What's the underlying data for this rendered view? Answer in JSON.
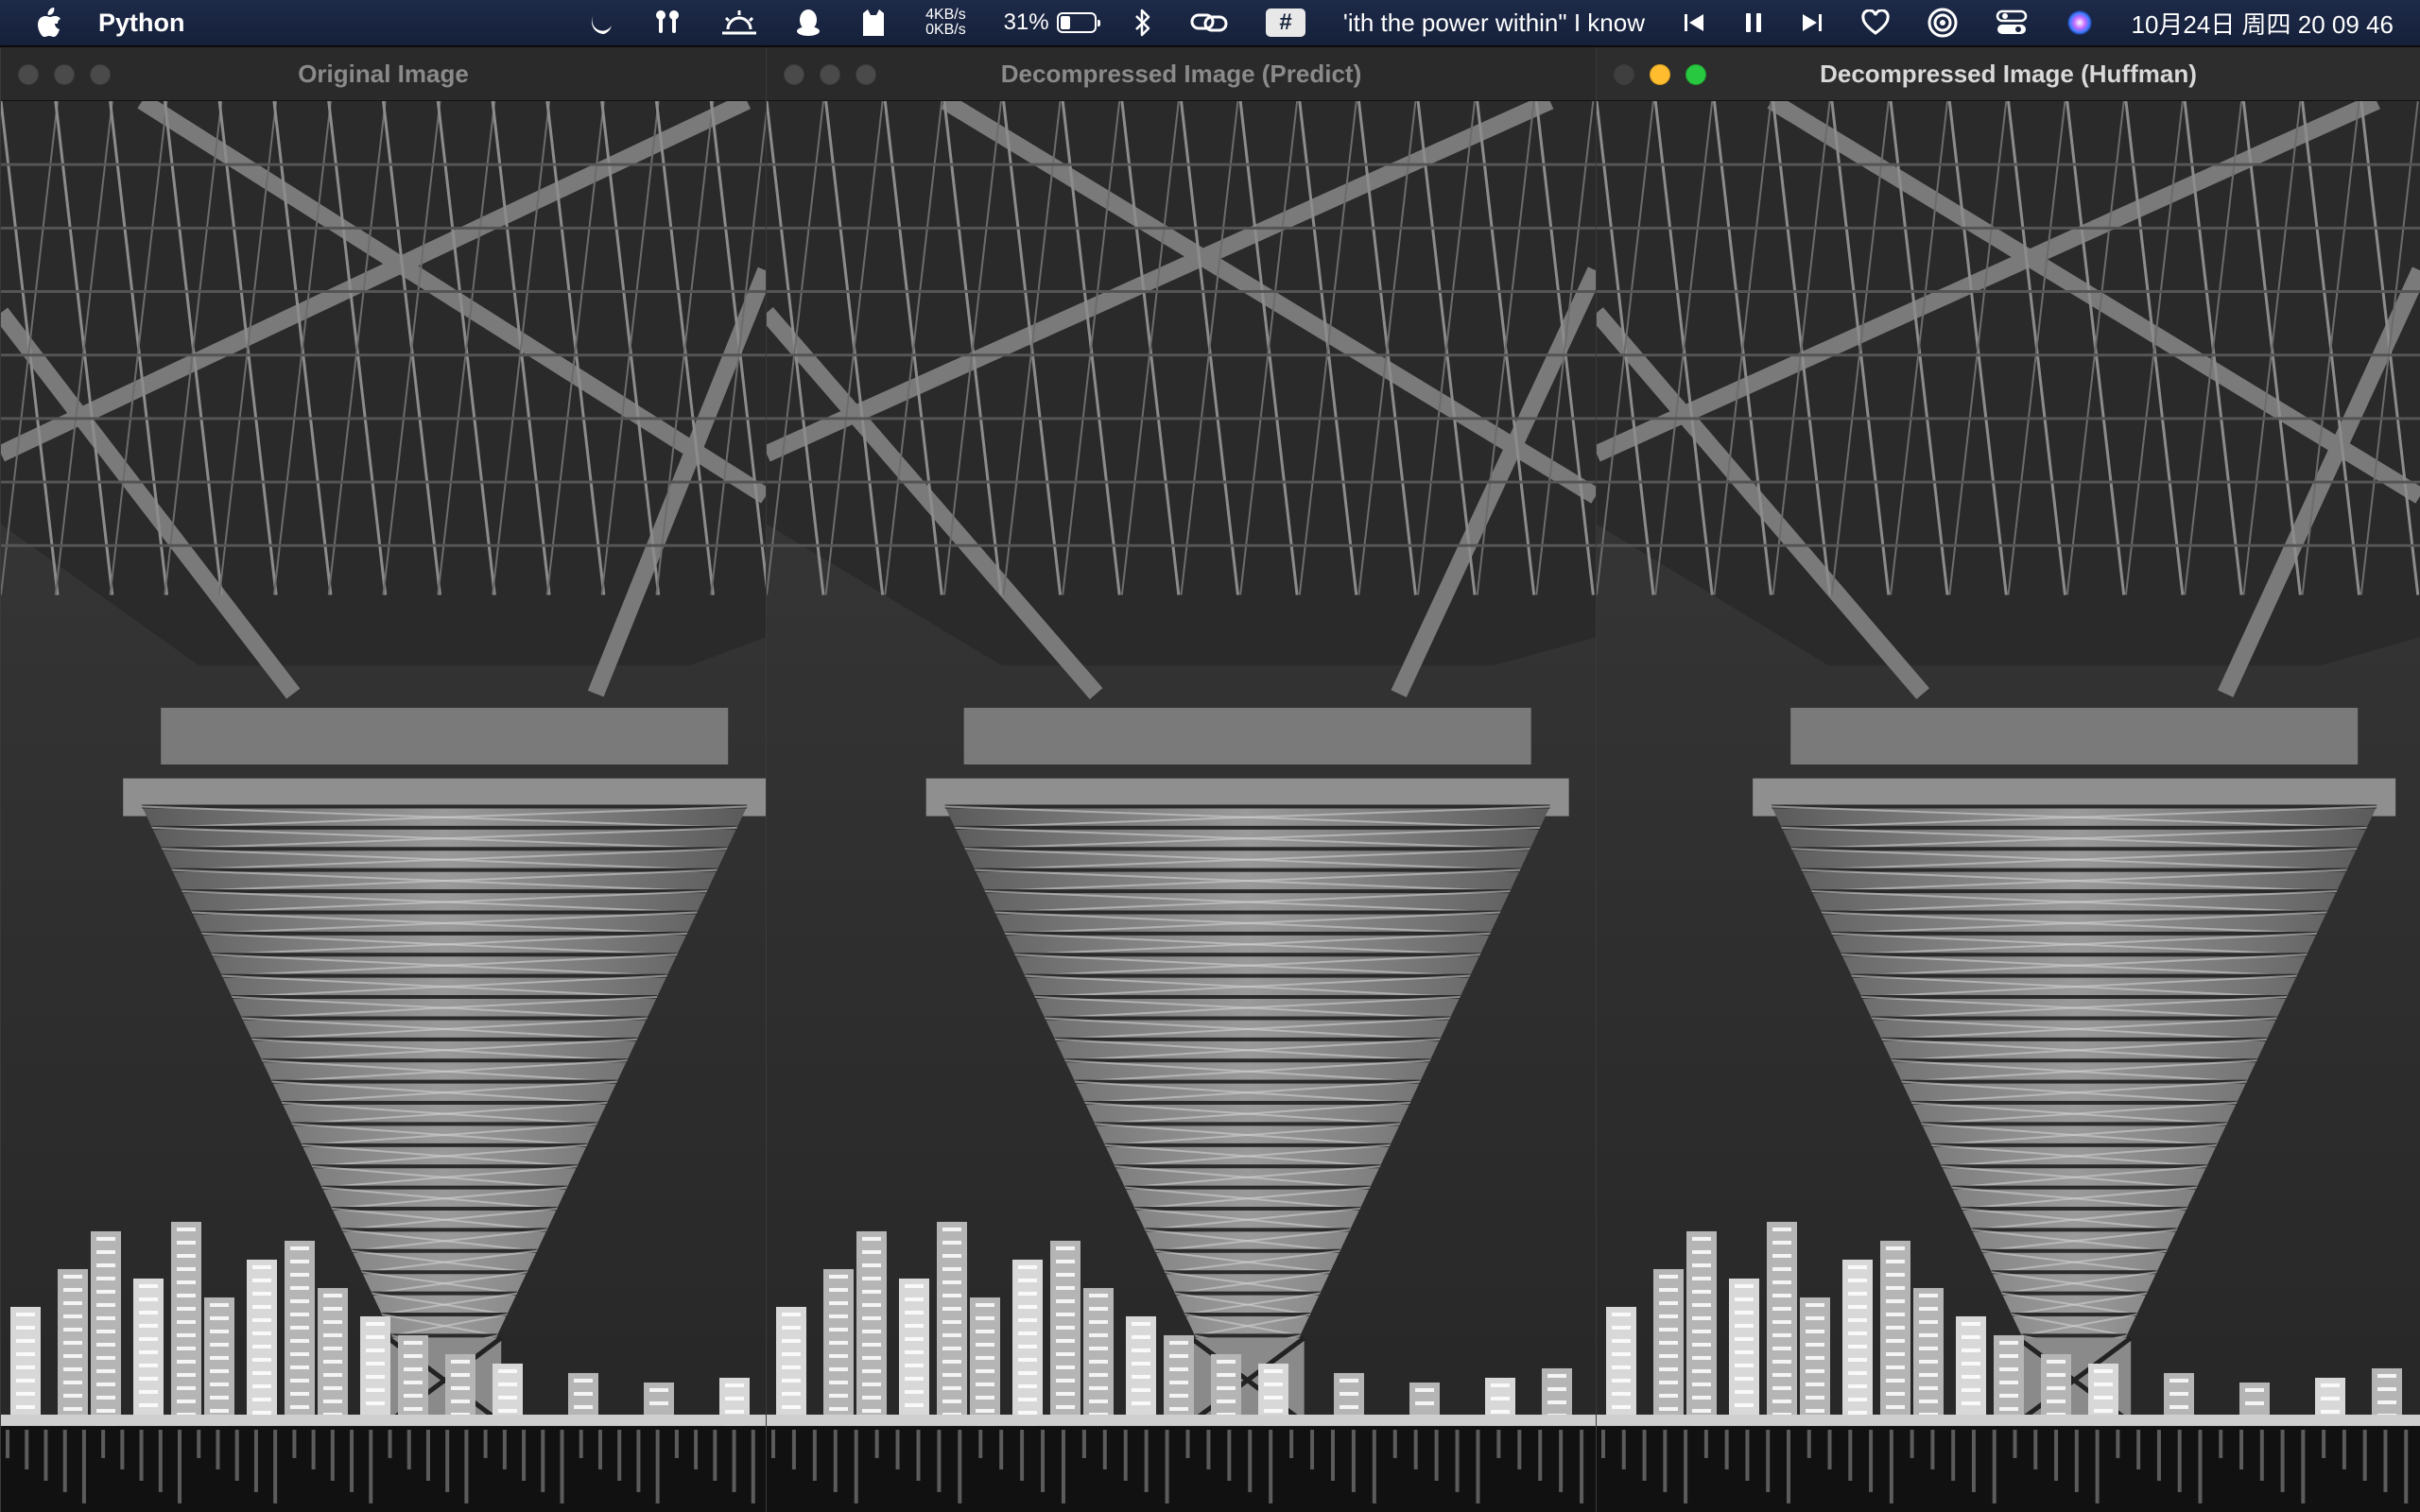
{
  "menubar": {
    "app_name": "Python",
    "icons": [
      "apple-icon",
      "moon-icon",
      "airpods-icon",
      "sunset-icon",
      "qq-penguin-icon",
      "cat-icon",
      "bluetooth-icon",
      "link-icon",
      "heart-icon",
      "music-app-icon",
      "control-center-icon",
      "siri-icon"
    ],
    "net_up": "4KB/s",
    "net_down": "0KB/s",
    "battery_percent": "31%",
    "battery_level": 0.31,
    "hash_badge": "#",
    "now_playing": "ʹith the power within\" I know",
    "clock": "10月24日 周四  20 09 46"
  },
  "windows": [
    {
      "title": "Original Image",
      "active": false
    },
    {
      "title": "Decompressed Image (Predict)",
      "active": false
    },
    {
      "title": "Decompressed Image (Huffman)",
      "active": true
    }
  ]
}
